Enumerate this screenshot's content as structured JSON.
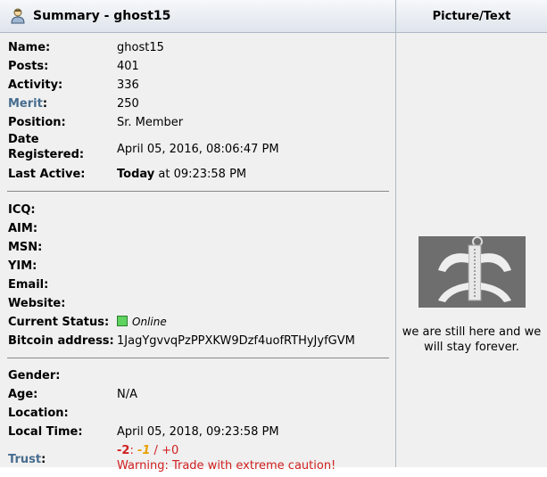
{
  "header": {
    "title": "Summary - ghost15",
    "picture_text": "Picture/Text"
  },
  "profile": {
    "name": {
      "label": "Name:",
      "value": "ghost15"
    },
    "posts": {
      "label": "Posts:",
      "value": "401"
    },
    "activity": {
      "label": "Activity:",
      "value": "336"
    },
    "merit": {
      "label": "Merit",
      "colon": ":",
      "value": "250"
    },
    "position": {
      "label": "Position:",
      "value": "Sr. Member"
    },
    "date_registered": {
      "label_line1": "Date",
      "label_line2": "Registered:",
      "value": "April 05, 2016, 08:06:47 PM"
    },
    "last_active": {
      "label": "Last Active:",
      "value_bold": "Today",
      "value_rest": " at 09:23:58 PM"
    },
    "icq": {
      "label": "ICQ:"
    },
    "aim": {
      "label": "AIM:"
    },
    "msn": {
      "label": "MSN:"
    },
    "yim": {
      "label": "YIM:"
    },
    "email": {
      "label": "Email:"
    },
    "website": {
      "label": "Website:"
    },
    "current_status": {
      "label": "Current Status:",
      "value": "Online"
    },
    "bitcoin": {
      "label": "Bitcoin address:",
      "value": "1JagYgvvqPzPPXKW9Dzf4uofRTHyJyfGVM"
    },
    "gender": {
      "label": "Gender:"
    },
    "age": {
      "label": "Age:",
      "value": "N/A"
    },
    "location": {
      "label": "Location:"
    },
    "local_time": {
      "label": "Local Time:",
      "value": "April 05, 2018, 09:23:58 PM"
    },
    "trust": {
      "label": "Trust",
      "colon": ":",
      "neg": "-2",
      "sep1": ": ",
      "mid": "-1",
      "rest": " / +0",
      "warning": "Warning: Trade with extreme caution!"
    }
  },
  "picture": {
    "text": "we are still here and we will stay forever."
  },
  "colors": {
    "merit": "#476c8e",
    "warning": "#d02020",
    "online": "#5fd35f"
  }
}
